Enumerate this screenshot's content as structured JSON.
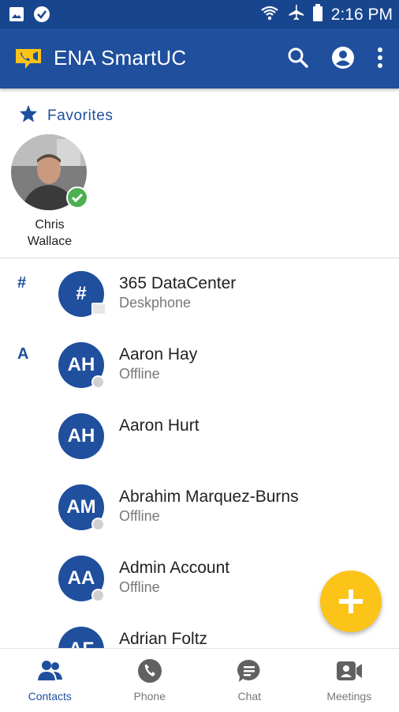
{
  "status_bar": {
    "time": "2:16 PM"
  },
  "app_bar": {
    "title": "ENA SmartUC",
    "icons": [
      "search-icon",
      "account-icon",
      "more-vert-icon"
    ]
  },
  "favorites": {
    "label": "Favorites",
    "items": [
      {
        "name": "Chris Wallace",
        "status": "online"
      }
    ]
  },
  "contacts": {
    "sections": [
      {
        "letter": "#",
        "items": [
          {
            "initials": "#",
            "name": "365 DataCenter",
            "status": "Deskphone"
          }
        ]
      },
      {
        "letter": "A",
        "items": [
          {
            "initials": "AH",
            "name": "Aaron Hay",
            "status": "Offline"
          },
          {
            "initials": "AH",
            "name": "Aaron Hurt",
            "status": ""
          },
          {
            "initials": "AM",
            "name": "Abrahim Marquez-Burns",
            "status": "Offline"
          },
          {
            "initials": "AA",
            "name": "Admin Account",
            "status": "Offline"
          },
          {
            "initials": "AF",
            "name": "Adrian Foltz",
            "status": ""
          }
        ]
      }
    ]
  },
  "fab": {
    "icon": "plus-icon"
  },
  "bottom_nav": {
    "tabs": [
      {
        "label": "Contacts",
        "active": true
      },
      {
        "label": "Phone",
        "active": false
      },
      {
        "label": "Chat",
        "active": false
      },
      {
        "label": "Meetings",
        "active": false
      }
    ]
  },
  "colors": {
    "primary": "#1f4f9d",
    "status_bar": "#17468f",
    "accent": "#fcc419",
    "online": "#4caf50"
  }
}
